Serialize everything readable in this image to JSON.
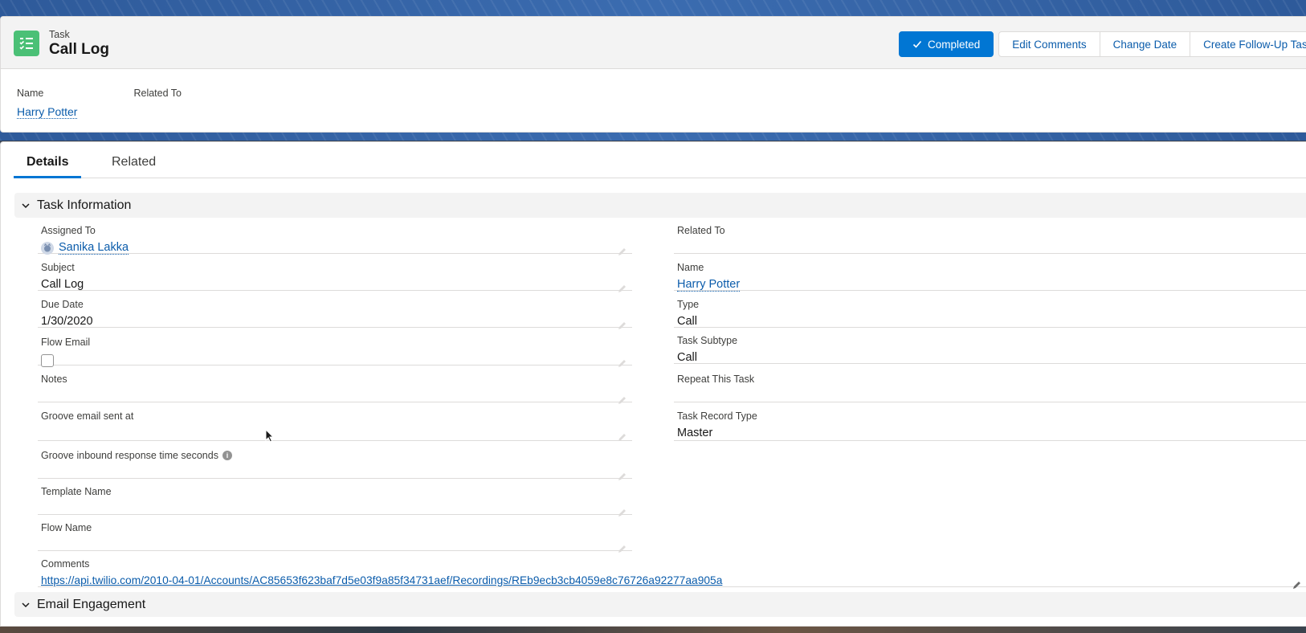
{
  "header": {
    "object_type": "Task",
    "record_title": "Call Log",
    "actions": {
      "completed": "Completed",
      "edit_comments": "Edit Comments",
      "change_date": "Change Date",
      "create_follow_up": "Create Follow-Up Task"
    },
    "highlights": {
      "name_label": "Name",
      "name_value": "Harry Potter",
      "related_to_label": "Related To"
    }
  },
  "tabs": {
    "details": "Details",
    "related": "Related"
  },
  "sections": {
    "task_information": "Task Information",
    "email_engagement": "Email Engagement"
  },
  "fields": {
    "assigned_to": {
      "label": "Assigned To",
      "value": "Sanika Lakka"
    },
    "subject": {
      "label": "Subject",
      "value": "Call Log"
    },
    "due_date": {
      "label": "Due Date",
      "value": "1/30/2020"
    },
    "flow_email": {
      "label": "Flow Email"
    },
    "notes": {
      "label": "Notes"
    },
    "groove_email_sent": {
      "label": "Groove email sent at"
    },
    "groove_inbound": {
      "label": "Groove inbound response time seconds"
    },
    "template_name": {
      "label": "Template Name"
    },
    "flow_name": {
      "label": "Flow Name"
    },
    "comments": {
      "label": "Comments",
      "value": "https://api.twilio.com/2010-04-01/Accounts/AC85653f623baf7d5e03f9a85f34731aef/Recordings/REb9ecb3cb4059e8c76726a92277aa905a"
    },
    "related_to": {
      "label": "Related To"
    },
    "name": {
      "label": "Name",
      "value": "Harry Potter"
    },
    "type": {
      "label": "Type",
      "value": "Call"
    },
    "task_subtype": {
      "label": "Task Subtype",
      "value": "Call"
    },
    "repeat_this_task": {
      "label": "Repeat This Task"
    },
    "task_record_type": {
      "label": "Task Record Type",
      "value": "Master"
    }
  },
  "colors": {
    "brand_blue": "#0176d3",
    "link_blue": "#0b5cab",
    "task_icon_green": "#4bc076"
  },
  "icons": [
    "task-icon",
    "check-icon",
    "chevron-down-icon",
    "pencil-icon",
    "info-icon",
    "avatar-icon",
    "mouse-cursor-icon"
  ]
}
